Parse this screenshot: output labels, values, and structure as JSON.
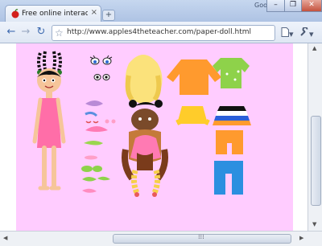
{
  "tab": {
    "title": "Free online interactive pa...",
    "close_glyph": "×",
    "new_tab_glyph": "+"
  },
  "browser": {
    "brand": "Google"
  },
  "window_controls": {
    "minimize": "–",
    "restore": "❐",
    "close": "✕"
  },
  "toolbar": {
    "url": "http://www.apples4theteacher.com/paper-doll.html",
    "back_glyph": "←",
    "forward_glyph": "→",
    "reload_glyph": "↻",
    "star_glyph": "☆",
    "page_menu_glyph": "▾",
    "tools_menu_glyph": "▾"
  },
  "scrollbars": {
    "up": "▲",
    "down": "▼",
    "left": "◀",
    "right": "▶",
    "grip": "⁞⁞⁞"
  },
  "colors": {
    "stage_background": "#ffccff",
    "doll_dress": "#ff6ea8",
    "skin": "#f6c59a"
  }
}
